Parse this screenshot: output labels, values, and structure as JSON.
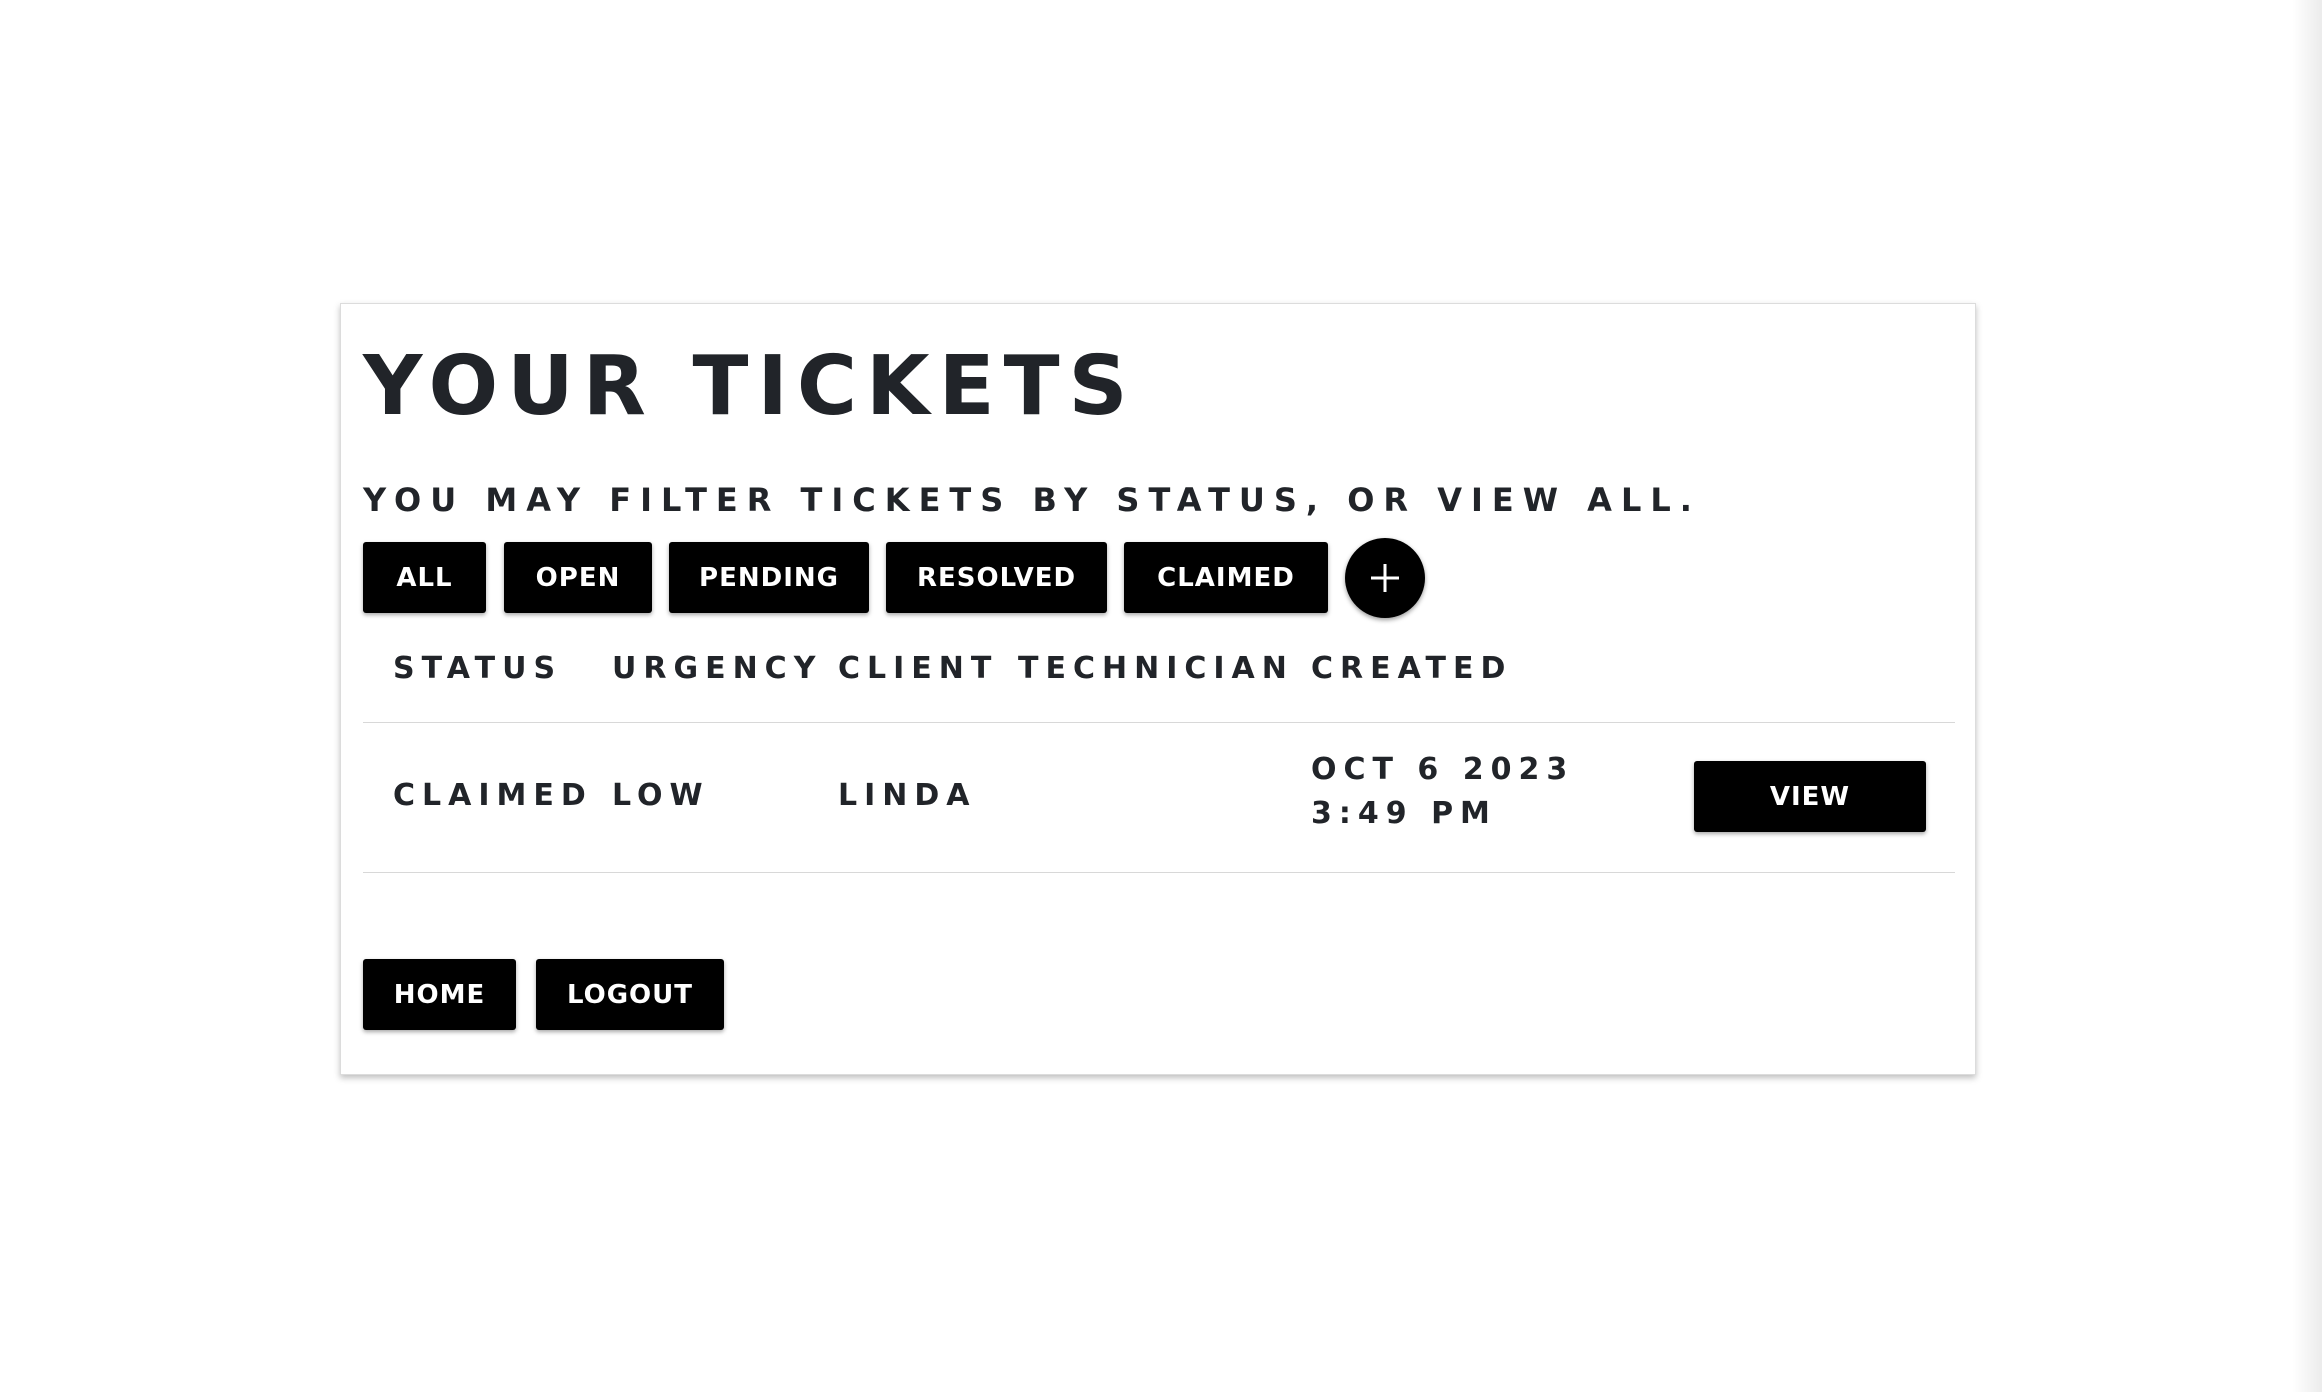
{
  "page": {
    "title": "YOUR TICKETS",
    "subtitle": "YOU MAY FILTER TICKETS BY STATUS, OR VIEW ALL."
  },
  "filters": {
    "all": "ALL",
    "open": "OPEN",
    "pending": "PENDING",
    "resolved": "RESOLVED",
    "claimed": "CLAIMED",
    "add_icon": "plus-icon"
  },
  "table": {
    "headers": {
      "status": "STATUS",
      "urgency": "URGENCY",
      "client": "CLIENT",
      "technician": "TECHNICIAN",
      "created": "CREATED"
    },
    "rows": [
      {
        "status": "CLAIMED",
        "urgency": "LOW",
        "client": "LINDA",
        "technician": "",
        "created": "OCT 6 2023 3:49 PM",
        "action": "VIEW"
      }
    ]
  },
  "footer": {
    "home": "HOME",
    "logout": "LOGOUT"
  },
  "colors": {
    "button_bg": "#000000",
    "button_text": "#ffffff",
    "text": "#212429",
    "divider": "#d8d8d8"
  }
}
